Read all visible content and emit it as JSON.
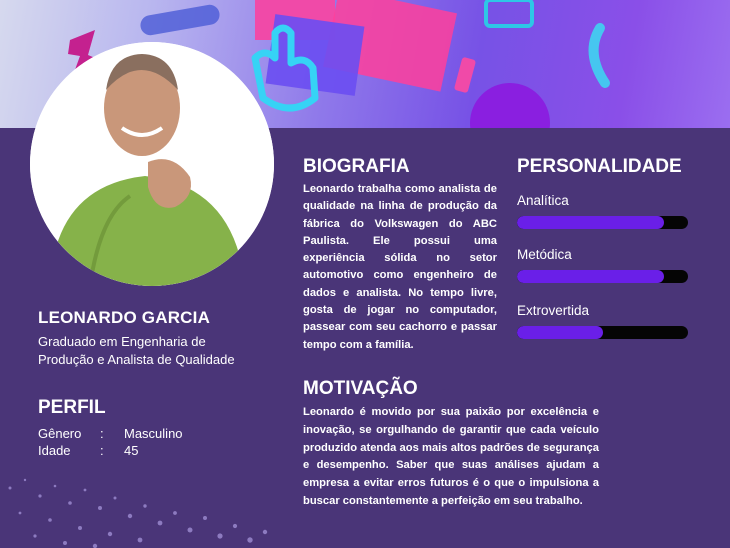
{
  "person": {
    "name": "LEONARDO GARCIA",
    "subtitle": "Graduado em Engenharia de Produção e Analista de Qualidade"
  },
  "perfil": {
    "title": "PERFIL",
    "rows": [
      {
        "label": "Gênero",
        "sep": ":",
        "value": "Masculino"
      },
      {
        "label": "Idade",
        "sep": ":",
        "value": "45"
      }
    ]
  },
  "biografia": {
    "title": "BIOGRAFIA",
    "text": "Leonardo trabalha como analista de qualidade na linha de produção da fábrica do Volkswagen do ABC Paulista. Ele possui uma experiência sólida no setor automotivo como engenheiro de dados e analista. No tempo livre, gosta de jogar no computador, passear com seu cachorro e passar tempo com a família."
  },
  "motivacao": {
    "title": "MOTIVAÇÃO",
    "text": "Leonardo é movido por sua paixão por excelência e inovação, se orgulhando de garantir que cada veículo produzido atenda aos mais altos padrões de segurança e desempenho. Saber que suas análises ajudam a empresa a evitar erros futuros é o que o impulsiona a buscar constantemente a perfeição em seu trabalho."
  },
  "personalidade": {
    "title": "PERSONALIDADE",
    "traits": [
      {
        "label": "Analítica",
        "level": 0.86
      },
      {
        "label": "Metódica",
        "level": 0.86
      },
      {
        "label": "Extrovertida",
        "level": 0.5
      }
    ]
  },
  "colors": {
    "panel": "#4a3578",
    "bar_fill": "#6a1fe8",
    "bar_track": "#050505"
  },
  "icons": {
    "banner": "abstract-3d-shapes-pointing-hand",
    "photo": "person-portrait"
  }
}
